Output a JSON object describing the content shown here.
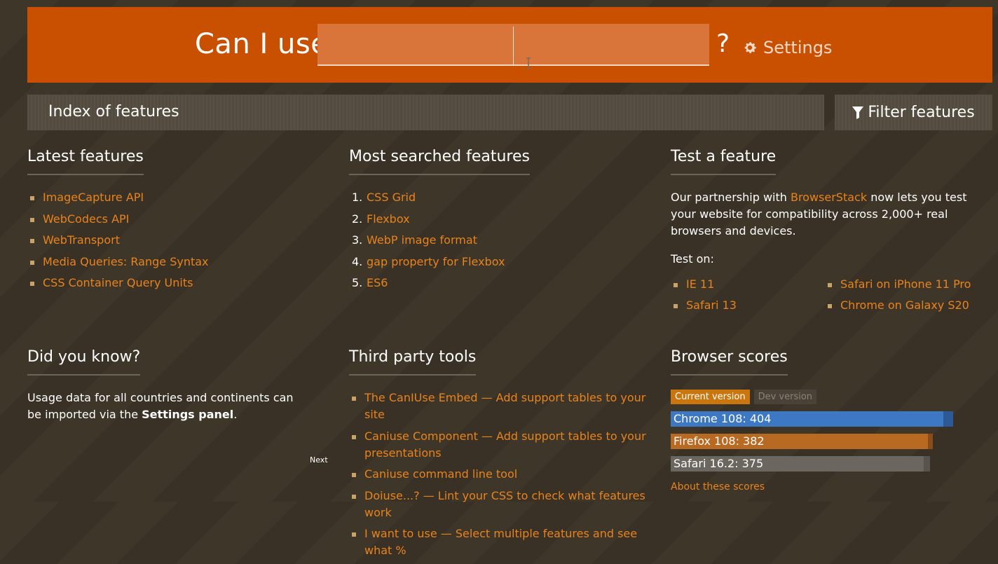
{
  "header": {
    "brand": "Can I use",
    "search_value": "",
    "question_mark": "?",
    "settings_label": "Settings",
    "accent_color": "#c95000"
  },
  "index_bar": {
    "title": "Index of features",
    "filter_label": "Filter features"
  },
  "latest": {
    "title": "Latest features",
    "items": [
      "ImageCapture API",
      "WebCodecs API",
      "WebTransport",
      "Media Queries: Range Syntax",
      "CSS Container Query Units"
    ]
  },
  "most_searched": {
    "title": "Most searched features",
    "items": [
      {
        "num": "1.",
        "label": "CSS Grid"
      },
      {
        "num": "2.",
        "label": "Flexbox"
      },
      {
        "num": "3.",
        "label": "WebP image format"
      },
      {
        "num": "4.",
        "label": "gap property for Flexbox"
      },
      {
        "num": "5.",
        "label": "ES6"
      }
    ]
  },
  "test_feature": {
    "title": "Test a feature",
    "text_before": "Our partnership with ",
    "link": "BrowserStack",
    "text_after": " now lets you test your website for compatibility across 2,000+ real browsers and devices.",
    "test_on": "Test on:",
    "items": [
      "IE 11",
      "Safari on iPhone 11 Pro",
      "Safari 13",
      "Chrome on Galaxy S20"
    ]
  },
  "did_you_know": {
    "title": "Did you know?",
    "text_before": "Usage data for all countries and continents can be imported via the ",
    "bold": "Settings panel",
    "text_after": ".",
    "next_label": "Next"
  },
  "third_party": {
    "title": "Third party tools",
    "items": [
      "The CanIUse Embed — Add support tables to your site",
      "Caniuse Component — Add support tables to your presentations",
      "Caniuse command line tool",
      "Doiuse...? — Lint your CSS to check what features work",
      "I want to use — Select multiple features and see what %"
    ]
  },
  "browser_scores": {
    "title": "Browser scores",
    "tab_current": "Current version",
    "tab_dev": "Dev version",
    "max_score": 420,
    "bars": [
      {
        "label": "Chrome 108: 404",
        "score": 404,
        "dev_score": 419,
        "color": "#3d78c4",
        "dev_color": "#2d5a96"
      },
      {
        "label": "Firefox 108: 382",
        "score": 382,
        "dev_score": 389,
        "color": "#b86a22",
        "dev_color": "#8a4d1a"
      },
      {
        "label": "Safari 16.2: 375",
        "score": 375,
        "dev_score": 385,
        "color": "#6b6660",
        "dev_color": "#57534e"
      }
    ],
    "about_label": "About these scores"
  }
}
